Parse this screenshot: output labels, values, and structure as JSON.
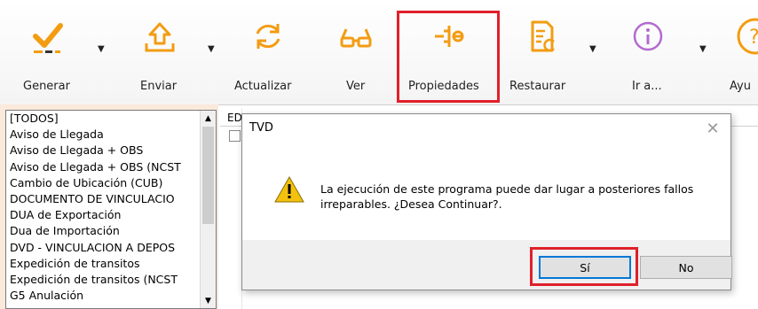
{
  "toolbar": {
    "buttons": [
      {
        "label": "Generar",
        "icon": "check-icon"
      },
      {
        "label": "Enviar",
        "icon": "upload-icon"
      },
      {
        "label": "Actualizar",
        "icon": "refresh-icon"
      },
      {
        "label": "Ver",
        "icon": "glasses-icon"
      },
      {
        "label": "Propiedades",
        "icon": "properties-icon"
      },
      {
        "label": "Restaurar",
        "icon": "restore-icon"
      },
      {
        "label": "Ir a...",
        "icon": "info-icon"
      },
      {
        "label": "Ayu",
        "icon": "help-icon"
      }
    ],
    "colors": {
      "accent_orange": "#f39c12",
      "info_purple": "#b36ad1",
      "highlight_red": "#e0202a"
    }
  },
  "list": {
    "items": [
      "[TODOS]",
      "Aviso de Llegada",
      "Aviso de Llegada + OBS",
      "Aviso de Llegada + OBS (NCST",
      "Cambio de Ubicación (CUB)",
      "DOCUMENTO DE VINCULACIO",
      "DUA de Exportación",
      "Dua de Importación",
      "DVD - VINCULACION A DEPOS",
      "Expedición de transitos",
      "Expedición de transitos (NCST",
      "G5 Anulación"
    ]
  },
  "grid": {
    "column_header": "ED"
  },
  "dialog": {
    "title": "TVD",
    "message": "La ejecución de este programa puede dar lugar a posteriores fallos irreparables. ¿Desea Continuar?.",
    "yes_label": "Sí",
    "no_label": "No"
  }
}
